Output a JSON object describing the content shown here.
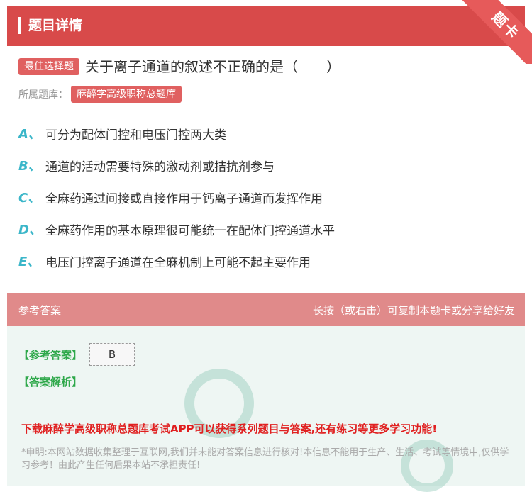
{
  "header": {
    "title": "题目详情"
  },
  "ribbon": {
    "label": "题卡"
  },
  "question": {
    "type_tag": "最佳选择题",
    "text": "关于离子通道的叙述不正确的是（　　）"
  },
  "library": {
    "label": "所属题库：",
    "name": "麻醉学高级职称总题库"
  },
  "options": [
    {
      "letter": "A、",
      "text": "可分为配体门控和电压门控两大类"
    },
    {
      "letter": "B、",
      "text": "通道的活动需要特殊的激动剂或拮抗剂参与"
    },
    {
      "letter": "C、",
      "text": "全麻药通过间接或直接作用于钙离子通道而发挥作用"
    },
    {
      "letter": "D、",
      "text": "全麻药作用的基本原理很可能统一在配体门控通道水平"
    },
    {
      "letter": "E、",
      "text": "电压门控离子通道在全麻机制上可能不起主要作用"
    }
  ],
  "answer_section": {
    "title": "参考答案",
    "hint": "长按（或右击）可复制本题卡或分享给好友",
    "answer_label": "【参考答案】",
    "answer_value": "B",
    "analysis_label": "【答案解析】",
    "promo": "下载麻醉学高级职称总题库考试APP可以获得系列题目与答案,还有练习等更多学习功能!",
    "disclaimer": "*申明:本网站数据收集整理于互联网,我们并未能对答案信息进行核对!本信息不能用于生产、生活、考试等情境中,仅供学习参考！由此产生任何后果本站不承担责任!"
  },
  "colors": {
    "header_bg": "#d84a4a",
    "tag_bg": "#e06060",
    "option_letter": "#3bb6c9",
    "answer_header_bg": "#e08a8a",
    "answer_body_bg": "#eef6f3",
    "answer_label": "#2ea84a",
    "promo": "#e02020"
  }
}
